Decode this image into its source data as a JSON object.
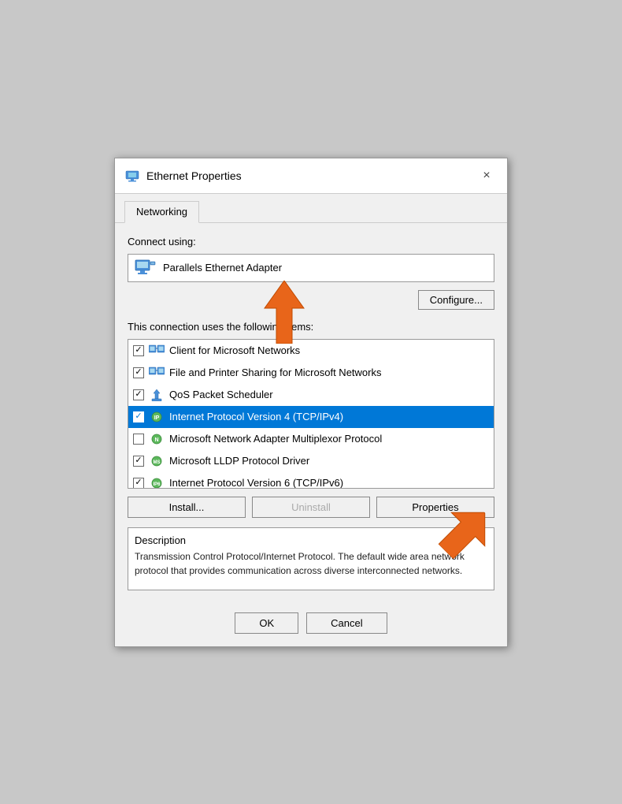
{
  "window": {
    "title": "Ethernet Properties",
    "close_label": "×"
  },
  "tabs": [
    {
      "label": "Networking",
      "active": true
    }
  ],
  "connect_using_label": "Connect using:",
  "adapter": {
    "name": "Parallels Ethernet Adapter"
  },
  "configure_btn": "Configure...",
  "connection_items_label": "This connection uses the following items:",
  "items": [
    {
      "id": 0,
      "checked": true,
      "text": "Client for Microsoft Networks",
      "selected": false
    },
    {
      "id": 1,
      "checked": true,
      "text": "File and Printer Sharing for Microsoft Networks",
      "selected": false
    },
    {
      "id": 2,
      "checked": true,
      "text": "QoS Packet Scheduler",
      "selected": false
    },
    {
      "id": 3,
      "checked": true,
      "text": "Internet Protocol Version 4 (TCP/IPv4)",
      "selected": true
    },
    {
      "id": 4,
      "checked": false,
      "text": "Microsoft Network Adapter Multiplexor Protocol",
      "selected": false
    },
    {
      "id": 5,
      "checked": true,
      "text": "Microsoft LLDP Protocol Driver",
      "selected": false
    },
    {
      "id": 6,
      "checked": true,
      "text": "Internet Protocol Version 6 (TCP/IPv6)",
      "selected": false
    }
  ],
  "buttons": {
    "install": "Install...",
    "uninstall": "Uninstall",
    "properties": "Properties"
  },
  "description": {
    "title": "Description",
    "text": "Transmission Control Protocol/Internet Protocol. The default wide area network protocol that provides communication across diverse interconnected networks."
  },
  "footer": {
    "ok": "OK",
    "cancel": "Cancel"
  }
}
